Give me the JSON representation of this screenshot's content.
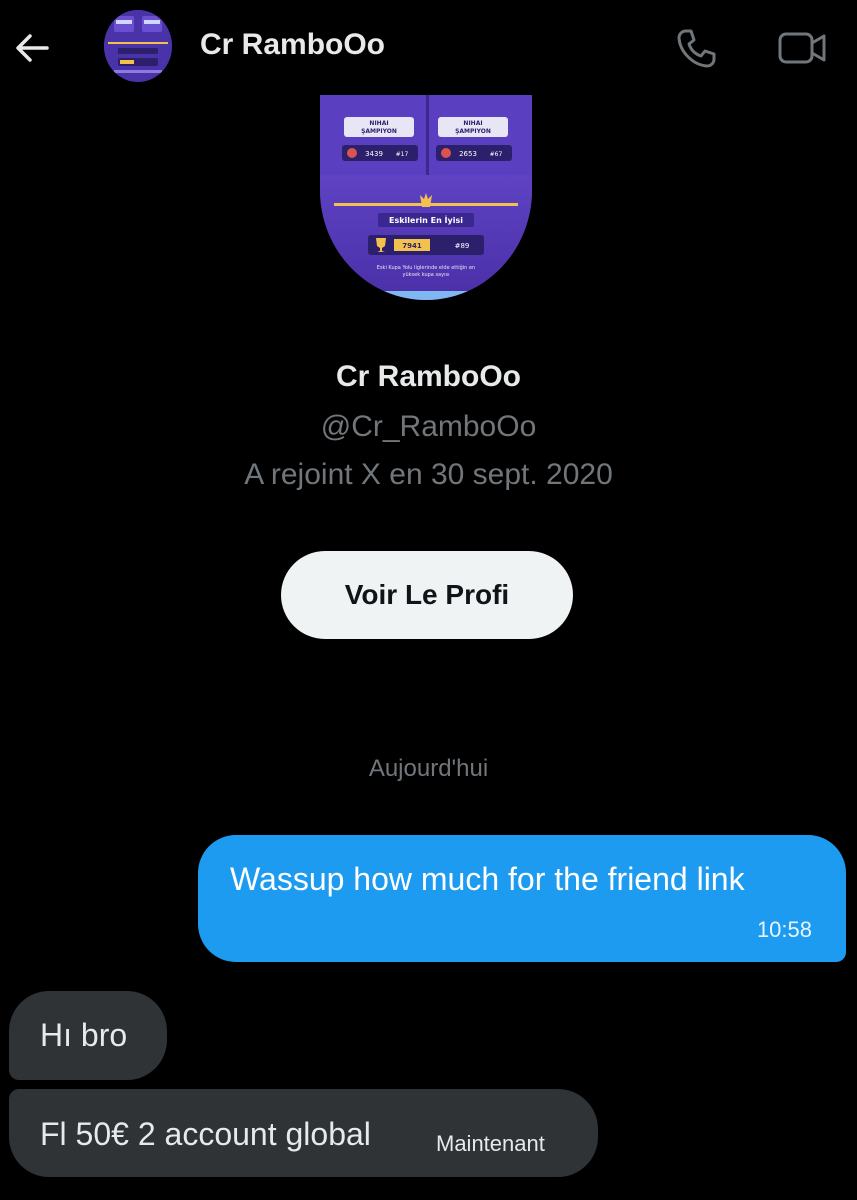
{
  "header": {
    "title": "Cr RamboOo",
    "back_icon": "arrow-left-icon",
    "call_icon": "phone-icon",
    "video_icon": "video-camera-icon"
  },
  "profile": {
    "name": "Cr RamboOo",
    "handle": "@Cr_RamboOo",
    "joined": "A rejoint X en 30 sept. 2020",
    "view_profile_label": "Voir Le Profi",
    "avatar_image": {
      "rank_left_title": "Nihai Şampiyon",
      "rank_left_trophies": "3439",
      "rank_left_pos": "#17",
      "rank_right_title": "Nihai Şampiyon",
      "rank_right_trophies": "2653",
      "rank_right_pos": "#67",
      "banner_title": "Eskilerin En İyisi",
      "best_trophies": "7941",
      "best_pos": "#89",
      "caption": "Eski Kupa Yolu liglerinde elde ettiğin en yüksek kupa sayısı"
    }
  },
  "conversation": {
    "date_separator": "Aujourd'hui",
    "messages": [
      {
        "direction": "outgoing",
        "text": "Wassup how much for the friend link",
        "time": "10:58"
      },
      {
        "direction": "incoming",
        "text": "Hı bro",
        "time": ""
      },
      {
        "direction": "incoming",
        "text": "Fl 50€ 2 account global",
        "time": "Maintenant"
      }
    ]
  },
  "colors": {
    "background": "#000000",
    "outgoing_bubble": "#1d9bf0",
    "incoming_bubble": "#2f3336",
    "muted_text": "#71767b",
    "button_bg": "#eff3f4"
  }
}
